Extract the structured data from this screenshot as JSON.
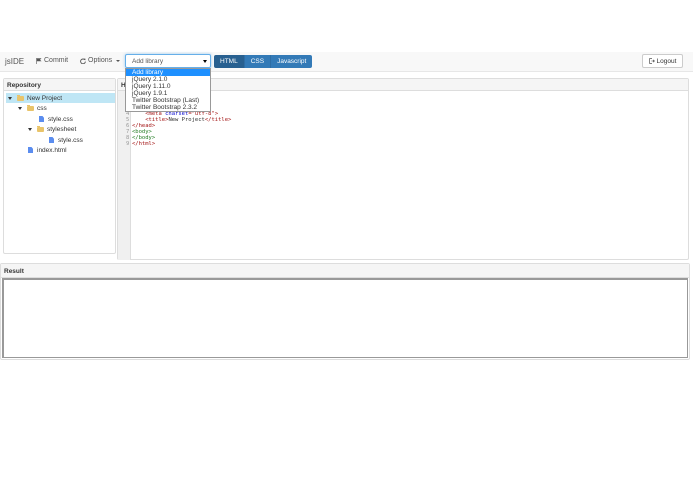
{
  "app": {
    "brand": "jsIDE"
  },
  "toolbar": {
    "commit_label": "Commit",
    "options_label": "Options",
    "logout_label": "Logout"
  },
  "library": {
    "selected": "Add library",
    "options": [
      "Add library",
      "jQuery 2.1.0",
      "jQuery 1.11.0",
      "jQuery 1.9.1",
      "Twitter Bootstrap (Last)",
      "Twitter Bootstrap 2.3.2"
    ]
  },
  "languages": [
    "HTML",
    "CSS",
    "Javascript"
  ],
  "repository": {
    "title": "Repository",
    "tree": [
      {
        "label": "New Project",
        "type": "folder",
        "selected": true
      },
      {
        "label": "css",
        "type": "folder"
      },
      {
        "label": "style.css",
        "type": "file"
      },
      {
        "label": "stylesheet",
        "type": "folder"
      },
      {
        "label": "style.css",
        "type": "file"
      },
      {
        "label": "index.html",
        "type": "file"
      }
    ]
  },
  "editor": {
    "title": "H",
    "lines": [
      {
        "n": "4",
        "indent": "    ",
        "parts": [
          [
            "tag",
            "<meta "
          ],
          [
            "attr",
            "charset"
          ],
          [
            "tag",
            "="
          ],
          [
            "str",
            "\"utf-8\""
          ],
          [
            "tag",
            ">"
          ]
        ]
      },
      {
        "n": "5",
        "indent": "    ",
        "parts": [
          [
            "tag",
            "<title>"
          ],
          [
            "plain",
            "New Project"
          ],
          [
            "tag",
            "</title>"
          ]
        ]
      },
      {
        "n": "6",
        "indent": "",
        "parts": [
          [
            "tag",
            "</head>"
          ]
        ]
      },
      {
        "n": "7",
        "indent": "",
        "parts": [
          [
            "tag2",
            "<body>"
          ]
        ]
      },
      {
        "n": "8",
        "indent": "",
        "parts": [
          [
            "tag2",
            "</body>"
          ]
        ]
      },
      {
        "n": "9",
        "indent": "",
        "parts": [
          [
            "tag",
            "</html>"
          ]
        ]
      }
    ]
  },
  "result": {
    "title": "Result"
  },
  "colors": {
    "primary": "#337ab7",
    "selected_row": "#bfe6f5",
    "dropdown_highlight": "#1e90ff"
  }
}
